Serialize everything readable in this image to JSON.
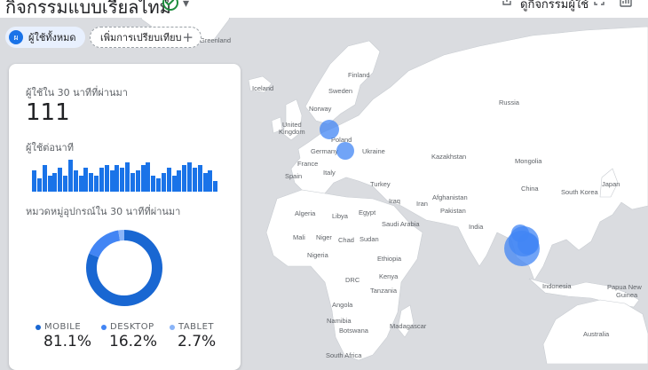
{
  "header": {
    "title": "กิจกรรมแบบเรียลไทม์",
    "right_label": "ดูกิจกรรมผู้ใช้"
  },
  "filters": {
    "audience_avatar": "ผ",
    "audience_label": "ผู้ใช้ทั้งหมด",
    "add_comparison_label": "เพิ่มการเปรียบเทียบ"
  },
  "card": {
    "users_30min_label": "ผู้ใช้ใน 30 นาทีที่ผ่านมา",
    "users_30min_value": "111",
    "users_per_minute_label": "ผู้ใช้ต่อนาที",
    "users_per_minute_values": [
      8,
      5,
      10,
      6,
      7,
      9,
      6,
      12,
      8,
      6,
      9,
      7,
      6,
      9,
      10,
      8,
      10,
      9,
      11,
      7,
      8,
      10,
      11,
      6,
      5,
      7,
      9,
      6,
      8,
      10,
      11,
      9,
      10,
      7,
      8,
      4
    ],
    "device_category_label": "หมวดหมู่อุปกรณ์ใน 30 นาทีที่ผ่านมา",
    "devices": [
      {
        "label": "MOBILE",
        "value": "81.1%",
        "share": 0.811,
        "color": "#1967d2"
      },
      {
        "label": "DESKTOP",
        "value": "16.2%",
        "share": 0.162,
        "color": "#4285f4"
      },
      {
        "label": "TABLET",
        "value": "2.7%",
        "share": 0.027,
        "color": "#8ab4f8"
      }
    ]
  },
  "map": {
    "labels": {
      "greenland": "Greenland",
      "finland": "Finland",
      "iceland": "Iceland",
      "sweden": "Sweden",
      "norway": "Norway",
      "russia": "Russia",
      "united_kingdom_1": "United",
      "united_kingdom_2": "Kingdom",
      "poland": "Poland",
      "germany": "Germany",
      "ukraine": "Ukraine",
      "france": "France",
      "kazakhstan": "Kazakhstan",
      "mongolia": "Mongolia",
      "spain": "Spain",
      "italy": "Italy",
      "turkey": "Turkey",
      "china": "China",
      "japan": "Japan",
      "south_korea": "South Korea",
      "afghanistan": "Afghanistan",
      "iraq": "Iraq",
      "iran": "Iran",
      "pakistan": "Pakistan",
      "algeria": "Algeria",
      "libya": "Libya",
      "egypt": "Egypt",
      "saudi_arabia": "Saudi Arabia",
      "india": "India",
      "mali": "Mali",
      "niger": "Niger",
      "chad": "Chad",
      "sudan": "Sudan",
      "nigeria": "Nigeria",
      "ethiopia": "Ethiopia",
      "drc": "DRC",
      "kenya": "Kenya",
      "tanzania": "Tanzania",
      "angola": "Angola",
      "namibia": "Namibia",
      "botswana": "Botswana",
      "madagascar": "Madagascar",
      "south_africa": "South Africa",
      "indonesia": "Indonesia",
      "papua_1": "Papua New",
      "papua_2": "Guinea",
      "australia": "Australia"
    }
  },
  "colors": {
    "map_water": "#dadce0",
    "map_land": "#ffffff",
    "marker": "#4285f4",
    "accent": "#1a73e8"
  }
}
